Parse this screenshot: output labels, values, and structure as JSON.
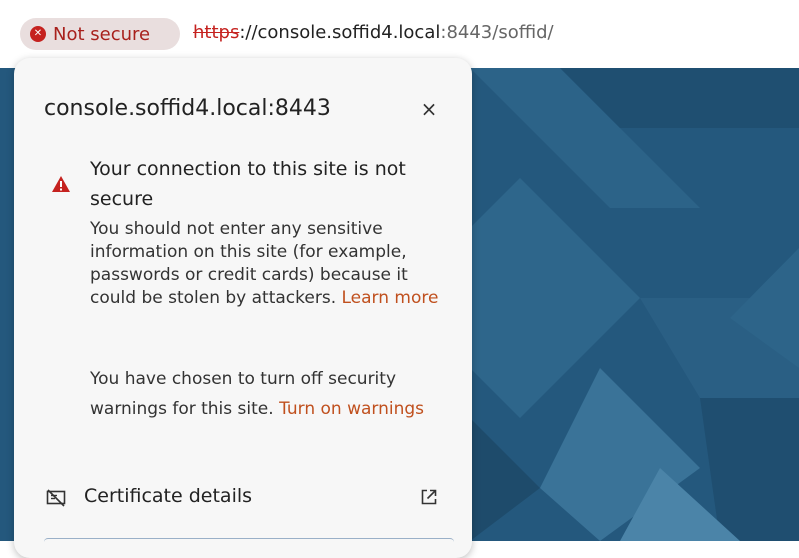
{
  "address_bar": {
    "security_chip": "Not secure",
    "url_scheme": "https",
    "url_host": "://console.soffid4.local",
    "url_port": ":8443",
    "url_path": "/soffid/"
  },
  "popup": {
    "title": "console.soffid4.local:8443",
    "close_label": "×",
    "warning_heading": "Your connection to this site is not secure",
    "warning_body": "You should not enter any sensitive information on this site (for example, passwords or credit cards) because it could be stolen by attackers.",
    "learn_more": "Learn more",
    "note_text": "You have chosen to turn off security warnings for this site.",
    "turn_on_link": "Turn on warnings",
    "certificate_label": "Certificate details"
  },
  "colors": {
    "danger": "#c5221f",
    "link": "#c0501e",
    "page_background": "#24587d"
  },
  "icons": [
    "error-circle-icon",
    "warning-triangle-icon",
    "close-icon",
    "certificate-icon",
    "external-link-icon"
  ]
}
